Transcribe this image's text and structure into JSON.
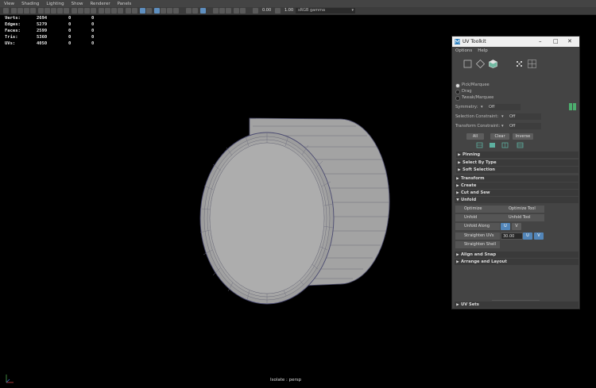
{
  "menubar": [
    "View",
    "Shading",
    "Lighting",
    "Show",
    "Renderer",
    "Panels"
  ],
  "toolbar": {
    "exposure": "0.00",
    "gamma": "1.00",
    "colorspace": "sRGB gamma"
  },
  "hud": [
    {
      "label": "Verts:",
      "a": "2694",
      "b": "0",
      "c": "0"
    },
    {
      "label": "Edges:",
      "a": "5279",
      "b": "0",
      "c": "0"
    },
    {
      "label": "Faces:",
      "a": "2599",
      "b": "0",
      "c": "0"
    },
    {
      "label": "Tris:",
      "a": "5360",
      "b": "0",
      "c": "0"
    },
    {
      "label": "UVs:",
      "a": "4050",
      "b": "0",
      "c": "0"
    }
  ],
  "status": "Isolate : persp",
  "panel": {
    "title": "UV Toolkit",
    "menu": [
      "Options",
      "Help"
    ],
    "modes": {
      "pick": "Pick/Marquee",
      "drag": "Drag",
      "tweak": "Tweak/Marquee"
    },
    "symmetry_label": "Symmetry:",
    "symmetry_value": "Off",
    "selection_constraint_label": "Selection Constraint:",
    "selection_constraint_value": "Off",
    "transform_constraint_label": "Transform Constraint:",
    "transform_constraint_value": "Off",
    "all": "All",
    "clear": "Clear",
    "inverse": "Inverse",
    "pinning": "Pinning",
    "select_by_type": "Select By Type",
    "soft_selection": "Soft Selection",
    "transform": "Transform",
    "create": "Create",
    "cut_and_sew": "Cut and Sew",
    "unfold": "Unfold",
    "optimize": "Optimize",
    "optimize_tool": "Optimize Tool",
    "unfold_btn": "Unfold",
    "unfold_tool": "Unfold Tool",
    "unfold_along": "Unfold Along",
    "u": "U",
    "v": "V",
    "straighten_uvs": "Straighten UVs",
    "straighten_value": "30.00",
    "straighten_shell": "Straighten Shell",
    "align_and_snap": "Align and Snap",
    "arrange_and_layout": "Arrange and Layout",
    "uv_sets": "UV Sets"
  },
  "colors": {
    "accent": "#5285b8",
    "panel": "#444444",
    "viewport": "#000000"
  }
}
